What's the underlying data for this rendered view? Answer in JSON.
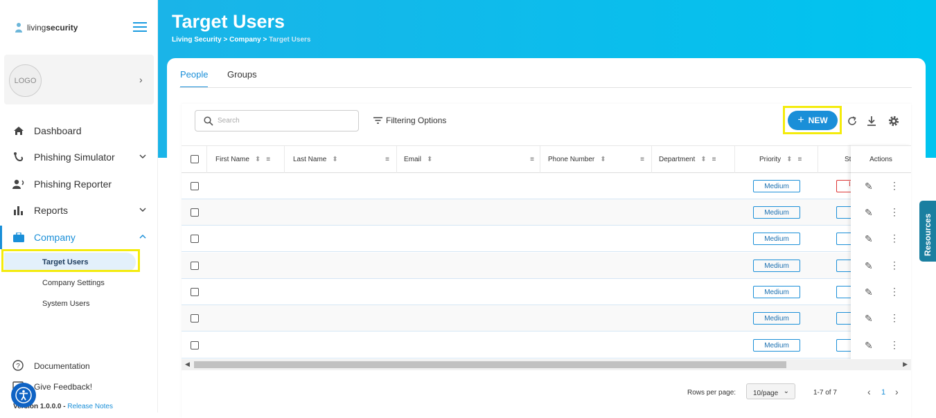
{
  "sidebar": {
    "brand": {
      "light": "living",
      "bold": "security"
    },
    "org_logo": "LOGO",
    "nav": [
      {
        "label": "Dashboard"
      },
      {
        "label": "Phishing Simulator"
      },
      {
        "label": "Phishing Reporter"
      },
      {
        "label": "Reports"
      },
      {
        "label": "Company"
      }
    ],
    "company_sub": [
      {
        "label": "Target Users"
      },
      {
        "label": "Company Settings"
      },
      {
        "label": "System Users"
      }
    ],
    "footer": {
      "documentation": "Documentation",
      "feedback": "Give Feedback!",
      "version": "Version 1.0.0.0 - ",
      "release_notes": "Release Notes"
    }
  },
  "header": {
    "title": "Target Users",
    "breadcrumb": [
      "Living Security",
      "Company",
      "Target Users"
    ],
    "separator": ">"
  },
  "tabs": [
    {
      "label": "People"
    },
    {
      "label": "Groups"
    }
  ],
  "toolbar": {
    "search_placeholder": "Search",
    "filter_label": "Filtering Options",
    "new_label": "NEW"
  },
  "table": {
    "columns": [
      "First Name",
      "Last Name",
      "Email",
      "Phone Number",
      "Department",
      "Priority",
      "St",
      "Actions"
    ],
    "rows": [
      {
        "priority": "Medium",
        "status": "In"
      },
      {
        "priority": "Medium",
        "status": ""
      },
      {
        "priority": "Medium",
        "status": ""
      },
      {
        "priority": "Medium",
        "status": ""
      },
      {
        "priority": "Medium",
        "status": ""
      },
      {
        "priority": "Medium",
        "status": ""
      },
      {
        "priority": "Medium",
        "status": ""
      }
    ]
  },
  "pagination": {
    "rows_label": "Rows per page:",
    "rows_value": "10/page",
    "range": "1-7 of 7",
    "current_page": "1"
  },
  "resources_tab": "Resources",
  "colors": {
    "accent": "#1a8fd8",
    "highlight": "#f4eb0b",
    "header_start": "#1ab4e8",
    "header_end": "#00c4ef"
  }
}
